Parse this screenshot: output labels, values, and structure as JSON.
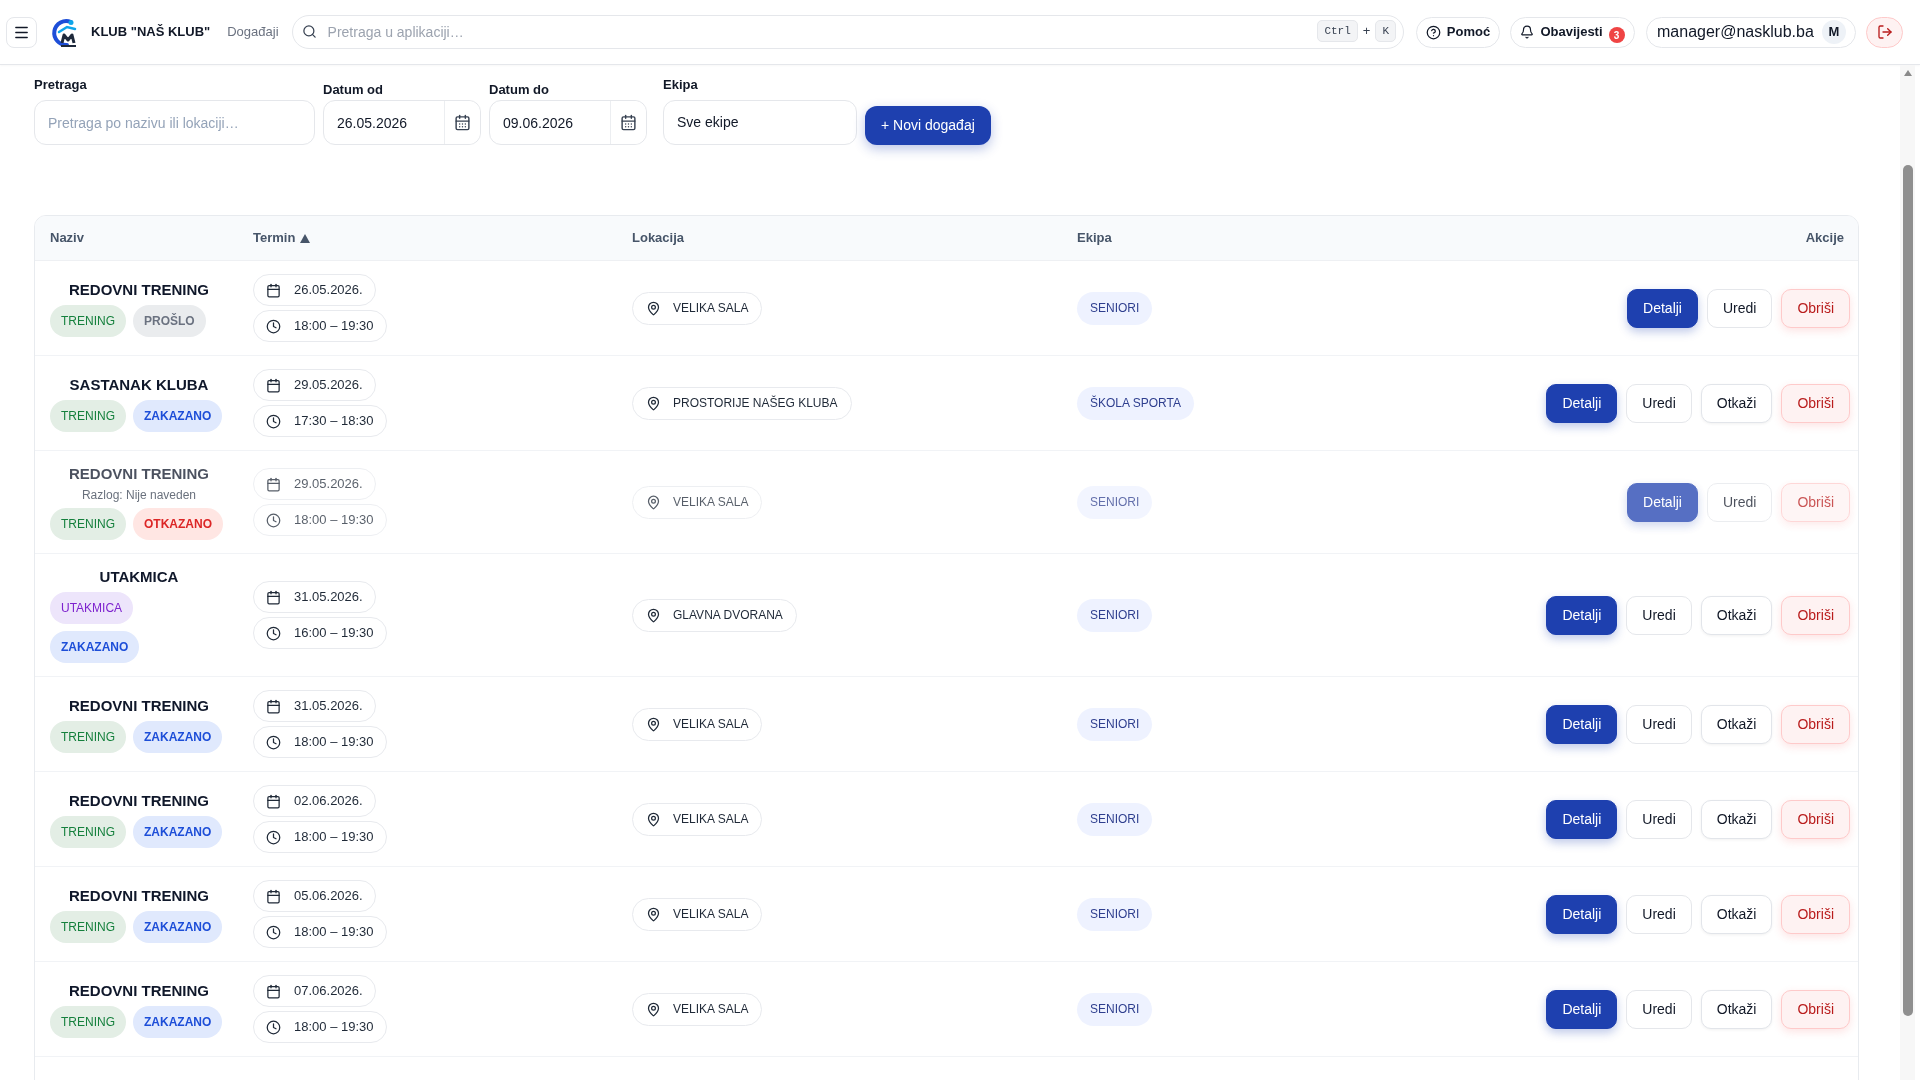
{
  "topbar": {
    "brand": "KLUB \"NAŠ KLUB\"",
    "section": "Događaji",
    "search": {
      "placeholder": "Pretraga u aplikaciji…",
      "keys": [
        "Ctrl",
        "K"
      ],
      "joiner": "+"
    },
    "help": "Pomoć",
    "notifications": {
      "label": "Obavijesti",
      "count": "3"
    },
    "user": {
      "email": "manager@nasklub.ba",
      "initial": "M"
    }
  },
  "filters": {
    "search": {
      "label": "Pretraga",
      "placeholder": "Pretraga po nazivu ili lokaciji…"
    },
    "date_from": {
      "label": "Datum od",
      "value": "26.05.2026"
    },
    "date_to": {
      "label": "Datum do",
      "value": "09.06.2026"
    },
    "team": {
      "label": "Ekipa",
      "value": "Sve ekipe"
    },
    "new_button": "+ Novi događaj"
  },
  "table": {
    "columns": [
      {
        "label": "Naziv",
        "sorted": false
      },
      {
        "label": "Termin",
        "sorted": true
      },
      {
        "label": "Lokacija",
        "sorted": false
      },
      {
        "label": "Ekipa",
        "sorted": false
      },
      {
        "label": "Akcije",
        "sorted": false
      }
    ],
    "rows": [
      {
        "name": "REDOVNI TRENING",
        "cancelled": false,
        "tags": [
          {
            "label": "TRENING",
            "kind": "type",
            "color": "#15803d"
          },
          {
            "label": "PROŠLO",
            "kind": "status",
            "color": "#6b7280"
          }
        ],
        "date": "26.05.2026.",
        "time": "18:00 – 19:30",
        "location": "VELIKA SALA",
        "team": "SENIORI",
        "actions": [
          {
            "label": "Detalji",
            "kind": "details"
          },
          {
            "label": "Uredi",
            "kind": "edit"
          },
          {
            "label": "Obriši",
            "kind": "delete"
          }
        ]
      },
      {
        "name": "SASTANAK KLUBA",
        "cancelled": false,
        "tags": [
          {
            "label": "TRENING",
            "kind": "type",
            "color": "#15803d"
          },
          {
            "label": "ZAKAZANO",
            "kind": "status",
            "color": "#1d4ed8"
          }
        ],
        "date": "29.05.2026.",
        "time": "17:30 – 18:30",
        "location": "PROSTORIJE NAŠEG KLUBA",
        "team": "ŠKOLA SPORTA",
        "actions": [
          {
            "label": "Detalji",
            "kind": "details"
          },
          {
            "label": "Uredi",
            "kind": "edit"
          },
          {
            "label": "Otkaži",
            "kind": "cancel"
          },
          {
            "label": "Obriši",
            "kind": "delete"
          }
        ]
      },
      {
        "name": "REDOVNI TRENING",
        "reason": "Razlog: Nije naveden",
        "cancelled": true,
        "tags": [
          {
            "label": "TRENING",
            "kind": "type",
            "color": "#15803d"
          },
          {
            "label": "OTKAZANO",
            "kind": "status",
            "color": "#dc2626"
          }
        ],
        "date": "29.05.2026.",
        "time": "18:00 – 19:30",
        "location": "VELIKA SALA",
        "team": "SENIORI",
        "actions": [
          {
            "label": "Detalji",
            "kind": "details"
          },
          {
            "label": "Uredi",
            "kind": "edit"
          },
          {
            "label": "Obriši",
            "kind": "delete"
          }
        ]
      },
      {
        "name": "UTAKMICA",
        "cancelled": false,
        "tags": [
          {
            "label": "UTAKMICA",
            "kind": "type",
            "color": "#7e22ce"
          },
          {
            "label": "ZAKAZANO",
            "kind": "status",
            "color": "#1d4ed8"
          }
        ],
        "date": "31.05.2026.",
        "time": "16:00 – 19:30",
        "location": "GLAVNA DVORANA",
        "team": "SENIORI",
        "actions": [
          {
            "label": "Detalji",
            "kind": "details"
          },
          {
            "label": "Uredi",
            "kind": "edit"
          },
          {
            "label": "Otkaži",
            "kind": "cancel"
          },
          {
            "label": "Obriši",
            "kind": "delete"
          }
        ]
      },
      {
        "name": "REDOVNI TRENING",
        "cancelled": false,
        "tags": [
          {
            "label": "TRENING",
            "kind": "type",
            "color": "#15803d"
          },
          {
            "label": "ZAKAZANO",
            "kind": "status",
            "color": "#1d4ed8"
          }
        ],
        "date": "31.05.2026.",
        "time": "18:00 – 19:30",
        "location": "VELIKA SALA",
        "team": "SENIORI",
        "actions": [
          {
            "label": "Detalji",
            "kind": "details"
          },
          {
            "label": "Uredi",
            "kind": "edit"
          },
          {
            "label": "Otkaži",
            "kind": "cancel"
          },
          {
            "label": "Obriši",
            "kind": "delete"
          }
        ]
      },
      {
        "name": "REDOVNI TRENING",
        "cancelled": false,
        "tags": [
          {
            "label": "TRENING",
            "kind": "type",
            "color": "#15803d"
          },
          {
            "label": "ZAKAZANO",
            "kind": "status",
            "color": "#1d4ed8"
          }
        ],
        "date": "02.06.2026.",
        "time": "18:00 – 19:30",
        "location": "VELIKA SALA",
        "team": "SENIORI",
        "actions": [
          {
            "label": "Detalji",
            "kind": "details"
          },
          {
            "label": "Uredi",
            "kind": "edit"
          },
          {
            "label": "Otkaži",
            "kind": "cancel"
          },
          {
            "label": "Obriši",
            "kind": "delete"
          }
        ]
      },
      {
        "name": "REDOVNI TRENING",
        "cancelled": false,
        "tags": [
          {
            "label": "TRENING",
            "kind": "type",
            "color": "#15803d"
          },
          {
            "label": "ZAKAZANO",
            "kind": "status",
            "color": "#1d4ed8"
          }
        ],
        "date": "05.06.2026.",
        "time": "18:00 – 19:30",
        "location": "VELIKA SALA",
        "team": "SENIORI",
        "actions": [
          {
            "label": "Detalji",
            "kind": "details"
          },
          {
            "label": "Uredi",
            "kind": "edit"
          },
          {
            "label": "Otkaži",
            "kind": "cancel"
          },
          {
            "label": "Obriši",
            "kind": "delete"
          }
        ]
      },
      {
        "name": "REDOVNI TRENING",
        "cancelled": false,
        "tags": [
          {
            "label": "TRENING",
            "kind": "type",
            "color": "#15803d"
          },
          {
            "label": "ZAKAZANO",
            "kind": "status",
            "color": "#1d4ed8"
          }
        ],
        "date": "07.06.2026.",
        "time": "18:00 – 19:30",
        "location": "VELIKA SALA",
        "team": "SENIORI",
        "actions": [
          {
            "label": "Detalji",
            "kind": "details"
          },
          {
            "label": "Uredi",
            "kind": "edit"
          },
          {
            "label": "Otkaži",
            "kind": "cancel"
          },
          {
            "label": "Obriši",
            "kind": "delete"
          }
        ]
      }
    ]
  }
}
